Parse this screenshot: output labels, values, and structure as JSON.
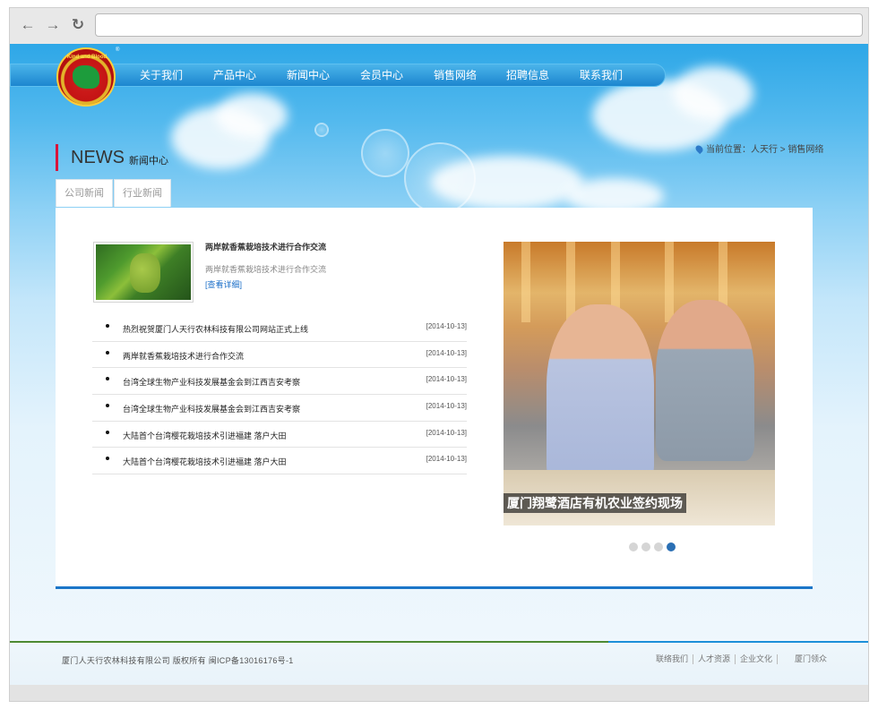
{
  "browser": {
    "back_icon": "←",
    "forward_icon": "→",
    "reload_icon": "↻",
    "url": ""
  },
  "logo": {
    "text": "Kind and Blood",
    "mark": "®"
  },
  "nav": {
    "items": [
      "关于我们",
      "产品中心",
      "新闻中心",
      "会员中心",
      "销售网络",
      "招聘信息",
      "联系我们"
    ]
  },
  "section": {
    "title_en": "NEWS",
    "title_cn": "新闻中心"
  },
  "breadcrumb": {
    "prefix": "当前位置：",
    "home": "人天行",
    "separator": ">",
    "current": "销售网络"
  },
  "tabs": [
    "公司新闻",
    "行业新闻"
  ],
  "featured": {
    "title": "两岸就香蕉栽培技术进行合作交流",
    "summary": "两岸就香蕉栽培技术进行合作交流",
    "more": "[查看详细]"
  },
  "news": [
    {
      "title": "热烈祝贺厦门人天行农林科技有限公司网站正式上线",
      "date": "[2014-10-13]"
    },
    {
      "title": "两岸就香蕉栽培技术进行合作交流",
      "date": "[2014-10-13]"
    },
    {
      "title": "台湾全球生物产业科技发展基金会到江西吉安考察",
      "date": "[2014-10-13]"
    },
    {
      "title": "台湾全球生物产业科技发展基金会到江西吉安考察",
      "date": "[2014-10-13]"
    },
    {
      "title": "大陆首个台湾樱花栽培技术引进福建 落户大田",
      "date": "[2014-10-13]"
    },
    {
      "title": "大陆首个台湾樱花栽培技术引进福建 落户大田",
      "date": "[2014-10-13]"
    }
  ],
  "slideshow": {
    "caption": "厦门翔鹭酒店有机农业签约现场",
    "total": 4,
    "active": 4
  },
  "footer": {
    "copyright": "厦门人天行农林科技有限公司 版权所有 闽ICP备13016176号-1",
    "links": [
      "联络我们",
      "人才资源",
      "企业文化",
      "厦门领众"
    ]
  },
  "colors": {
    "accent_red": "#d8153b",
    "accent_blue": "#1b76c8",
    "nav_blue": "#1c86cf"
  }
}
